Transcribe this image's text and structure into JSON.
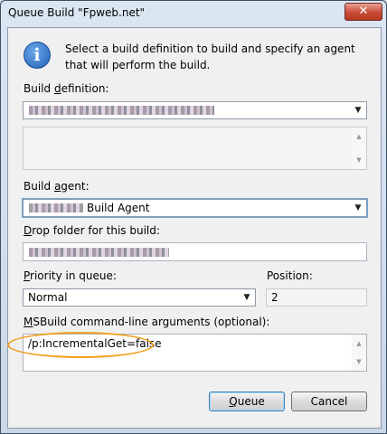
{
  "window": {
    "title": "Queue Build \"Fpweb.net\"",
    "close_glyph": "✕"
  },
  "info": {
    "icon": "info-icon",
    "glyph": "i",
    "text": "Select a build definition to build and specify an agent that will perform the build."
  },
  "build_definition": {
    "label_pre": "Build ",
    "label_accel": "d",
    "label_post": "efinition:",
    "value": ""
  },
  "build_agent": {
    "label_pre": "Build ",
    "label_accel": "a",
    "label_post": "gent:",
    "value": "Build Agent"
  },
  "drop_folder": {
    "label_accel": "D",
    "label_post": "rop folder for this build:",
    "value": ""
  },
  "priority": {
    "label_accel": "P",
    "label_post": "riority in queue:",
    "value": "Normal"
  },
  "position": {
    "label": "Position:",
    "value": "2"
  },
  "msbuild": {
    "label_accel": "M",
    "label_post": "SBuild command-line arguments (optional):",
    "value": "/p:IncrementalGet=false"
  },
  "buttons": {
    "queue_accel": "Q",
    "queue_post": "ueue",
    "cancel": "Cancel"
  },
  "colors": {
    "highlight": "#f0a020",
    "close": "#c94a35"
  }
}
